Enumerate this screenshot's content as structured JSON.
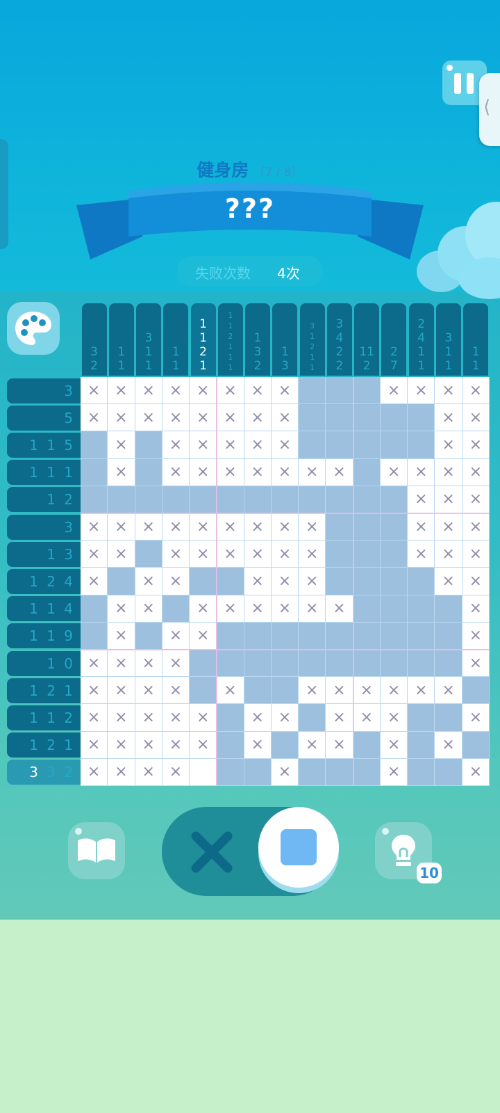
{
  "level": {
    "title": "健身房",
    "progress": "（7 / 8）",
    "name": "???"
  },
  "failures": {
    "label": "失败次数",
    "value": "4次"
  },
  "hint": {
    "count": "10"
  },
  "icons": {
    "pause": "pause-icon",
    "palette": "palette-icon",
    "book": "book-icon",
    "cross": "cross-mode-icon",
    "fill": "fill-mode-icon",
    "hint": "lightbulb-icon",
    "handle": "chevron-left-icon"
  },
  "puzzle": {
    "col_clues": [
      [
        "3",
        "2"
      ],
      [
        "1",
        "1"
      ],
      [
        "3",
        "1",
        "1"
      ],
      [
        "1",
        "1"
      ],
      [
        "1",
        "1",
        "2",
        "1"
      ],
      [
        "1",
        "1",
        "2",
        "1",
        "1",
        "1"
      ],
      [
        "1",
        "3",
        "2"
      ],
      [
        "1",
        "3"
      ],
      [
        "3",
        "1",
        "2",
        "1",
        "1"
      ],
      [
        "3",
        "4",
        "2",
        "2"
      ],
      [
        "11",
        "2"
      ],
      [
        "2",
        "7"
      ],
      [
        "2",
        "4",
        "1",
        "1"
      ],
      [
        "3",
        "1",
        "1"
      ],
      [
        "1",
        "1"
      ]
    ],
    "col_small": [
      false,
      false,
      false,
      false,
      false,
      true,
      false,
      false,
      true,
      false,
      false,
      false,
      false,
      false,
      false
    ],
    "active_col": 4,
    "row_clues": [
      [
        [
          "3",
          0
        ]
      ],
      [
        [
          "5",
          0
        ]
      ],
      [
        [
          "1 1 5",
          0
        ]
      ],
      [
        [
          "1 1 1",
          0
        ]
      ],
      [
        [
          "1 2",
          0
        ]
      ],
      [
        [
          "3",
          0
        ]
      ],
      [
        [
          "1 3",
          0
        ]
      ],
      [
        [
          "1 2 4",
          0
        ]
      ],
      [
        [
          "1 1 4",
          0
        ]
      ],
      [
        [
          "1 1 9",
          0
        ]
      ],
      [
        [
          "1 0",
          0
        ]
      ],
      [
        [
          "1 2 1",
          0
        ]
      ],
      [
        [
          "1 1 2",
          0
        ]
      ],
      [
        [
          "1 2 1",
          0
        ]
      ],
      [
        [
          "3",
          1
        ],
        [
          " 3 2",
          0
        ]
      ]
    ],
    "active_row": 14,
    "grid": [
      "xxxxxxxx...xxxx",
      "xxxxxxxx.....xx",
      ".x.xxxxx.....xx",
      ".x.xxxxxxx.xxxx",
      "............xxx",
      "xxxxxxxxx...xxx",
      "xx.xxxxxx...xxx",
      "x.xx..xxx....xx",
      ".xx.xxxxxx....x",
      ".x.xx.........x",
      "xxxx..........x",
      "xxxx.x..xxxxxx.",
      "xxxxx.xx.xxx..x",
      "xxxxx.x.xx.x.x.",
      "xxxx_..x...x..x"
    ]
  }
}
